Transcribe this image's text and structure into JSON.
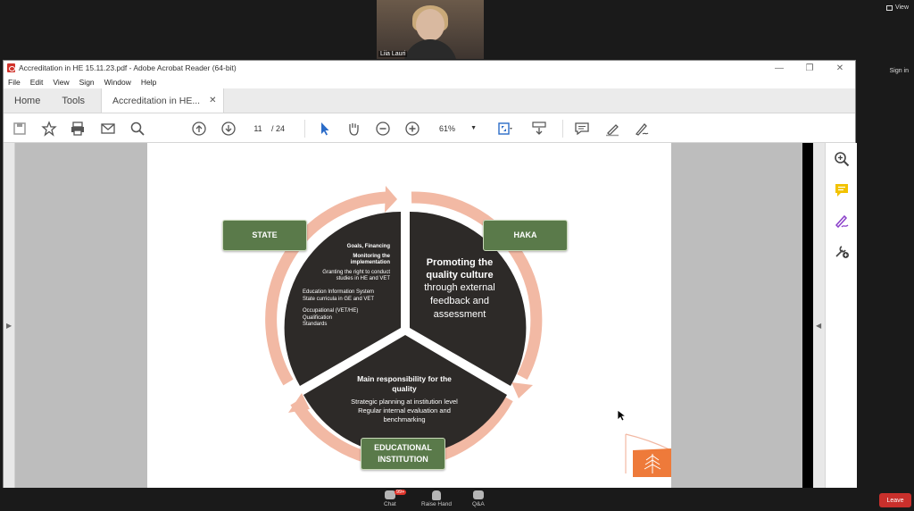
{
  "zoom": {
    "participant_name": "Liia Lauri",
    "view_label": "View",
    "signin_label": "Sign in",
    "chat_label": "Chat",
    "chat_badge": "99+",
    "raise_hand_label": "Raise Hand",
    "qa_label": "Q&A",
    "leave_label": "Leave"
  },
  "acrobat": {
    "window_title": "Accreditation in HE 15.11.23.pdf - Adobe Acrobat Reader (64-bit)",
    "menu": [
      "File",
      "Edit",
      "View",
      "Sign",
      "Window",
      "Help"
    ],
    "tabs": {
      "home": "Home",
      "tools": "Tools",
      "doc": "Accreditation in HE..."
    },
    "page_current": "11",
    "page_total": "/ 24",
    "zoom_level": "61%"
  },
  "slide": {
    "state_box": "STATE",
    "haka_box": "HAKA",
    "edu_box_line1": "EDUCATIONAL",
    "edu_box_line2": "INSTITUTION",
    "state_items": [
      "Goals, Financing",
      "Monitoring the",
      "implementation",
      "Granting the right to conduct",
      "studies in HE and VET",
      "Education Information System",
      "State curricula in GE and VET",
      "Occupational (VET/HE)",
      "Qualification",
      "Standards"
    ],
    "haka_title_1": "Promoting the",
    "haka_title_2": "quality culture",
    "haka_sub_1": "through external",
    "haka_sub_2": "feedback and",
    "haka_sub_3": "assessment",
    "edu_title_1": "Main responsibility for the",
    "edu_title_2": "quality",
    "edu_sub_1": "Strategic planning at institution level",
    "edu_sub_2": "Regular internal evaluation and",
    "edu_sub_3": "benchmarking"
  },
  "colors": {
    "segment": "#2d2a28",
    "ring": "#f2b9a4",
    "box_green": "#5a7a4a",
    "leave_red": "#c9302c",
    "logo_orange": "#ee7a3a"
  }
}
